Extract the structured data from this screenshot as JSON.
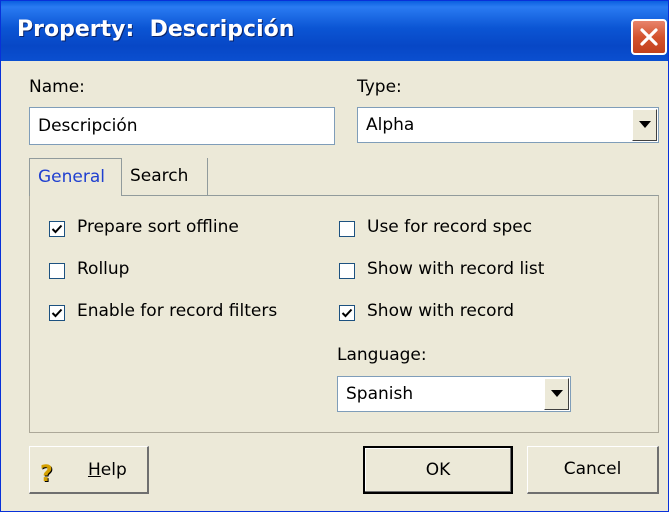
{
  "window": {
    "title": "Property:  Descripción"
  },
  "form": {
    "name_label": "Name:",
    "name_value": "Descripción",
    "type_label": "Type:",
    "type_value": "Alpha"
  },
  "tabs": [
    {
      "label": "General",
      "active": true
    },
    {
      "label": "Search",
      "active": false
    }
  ],
  "general": {
    "prepare_sort_offline": {
      "label": "Prepare sort offline",
      "checked": true
    },
    "rollup": {
      "label": "Rollup",
      "checked": false
    },
    "enable_record_filters": {
      "label": "Enable for record filters",
      "checked": true
    },
    "use_for_record_spec": {
      "label": "Use for record spec",
      "checked": false
    },
    "show_with_record_list": {
      "label": "Show with record list",
      "checked": false
    },
    "show_with_record": {
      "label": "Show with record",
      "checked": true
    },
    "language_label": "Language:",
    "language_value": "Spanish"
  },
  "buttons": {
    "help_first": "H",
    "help_rest": "elp",
    "ok": "OK",
    "cancel": "Cancel"
  },
  "icons": {
    "close": "close-icon",
    "help": "help-icon",
    "dropdown": "chevron-down-icon",
    "check": "checkmark-icon"
  }
}
